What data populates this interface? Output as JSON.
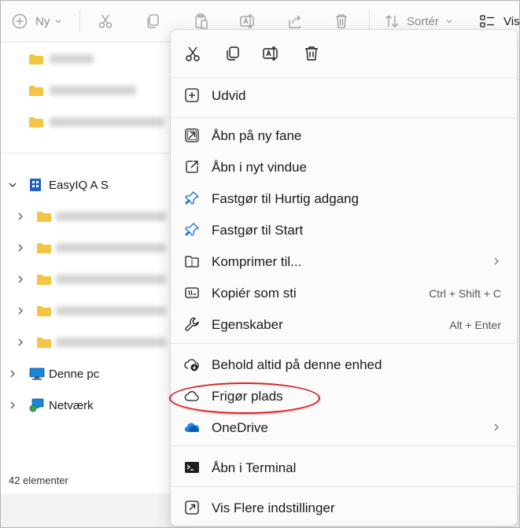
{
  "toolbar": {
    "new_label": "Ny",
    "sort_label": "Sortér",
    "view_label": "Vis"
  },
  "nav": {
    "section_label": "EasyIQ A S",
    "this_pc": "Denne pc",
    "network": "Netværk"
  },
  "status": {
    "count": "42 elementer"
  },
  "menu": {
    "items": [
      {
        "label": "Udvid"
      },
      {
        "label": "Åbn på ny fane"
      },
      {
        "label": "Åbn i nyt vindue"
      },
      {
        "label": "Fastgør til Hurtig adgang"
      },
      {
        "label": "Fastgør til Start"
      },
      {
        "label": "Komprimer til..."
      },
      {
        "label": "Kopiér som sti",
        "shortcut": "Ctrl + Shift + C"
      },
      {
        "label": "Egenskaber",
        "shortcut": "Alt + Enter"
      },
      {
        "label": "Behold altid på denne enhed"
      },
      {
        "label": "Frigør plads"
      },
      {
        "label": "OneDrive"
      },
      {
        "label": "Åbn i Terminal"
      },
      {
        "label": "Vis Flere indstillinger"
      }
    ]
  },
  "colors": {
    "accent": "#0067c0",
    "folder": "#f4c542",
    "highlight_ellipse": "#d32626"
  }
}
